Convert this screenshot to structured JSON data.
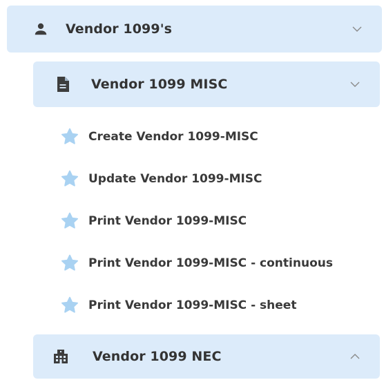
{
  "menu": {
    "top_group": {
      "label": "Vendor 1099's",
      "icon": "person-icon",
      "expanded": true
    },
    "misc_group": {
      "label": "Vendor 1099 MISC",
      "icon": "document-icon",
      "expanded": true,
      "items": [
        {
          "label": "Create Vendor 1099-MISC",
          "icon": "star-icon"
        },
        {
          "label": "Update Vendor 1099-MISC",
          "icon": "star-icon"
        },
        {
          "label": "Print Vendor 1099-MISC",
          "icon": "star-icon"
        },
        {
          "label": "Print Vendor 1099-MISC - continuous",
          "icon": "star-icon"
        },
        {
          "label": "Print Vendor 1099-MISC - sheet",
          "icon": "star-icon"
        }
      ]
    },
    "nec_group": {
      "label": "Vendor 1099 NEC",
      "icon": "building-icon",
      "expanded": false
    }
  },
  "colors": {
    "group_background": "#dcebfa",
    "star": "#a9d2f2",
    "text": "#333333",
    "icon": "#3d3d3d",
    "chevron": "#8a8a8a"
  }
}
